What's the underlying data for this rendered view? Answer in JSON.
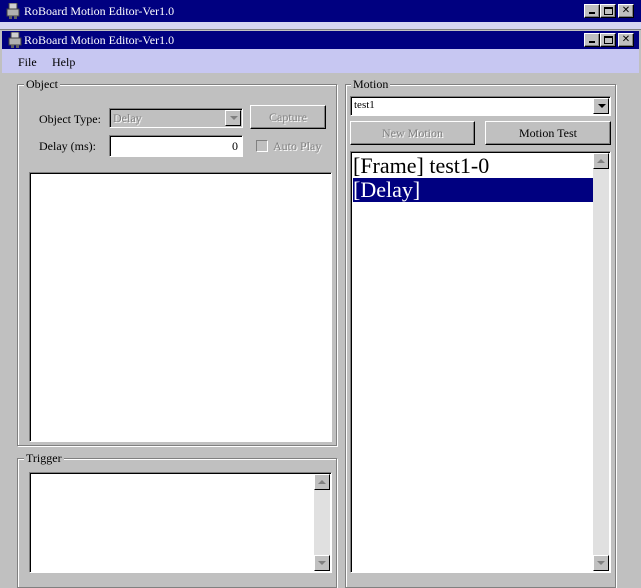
{
  "window_outer": {
    "title": "RoBoard Motion Editor-Ver1.0"
  },
  "window_inner": {
    "title": "RoBoard Motion Editor-Ver1.0"
  },
  "menu": {
    "file": "File",
    "help": "Help"
  },
  "object_group": {
    "label": "Object",
    "object_type_label": "Object Type:",
    "object_type_value": "Delay",
    "capture_button": "Capture",
    "delay_label": "Delay (ms):",
    "delay_value": "0",
    "auto_play_label": "Auto Play"
  },
  "trigger_group": {
    "label": "Trigger"
  },
  "motion_group": {
    "label": "Motion",
    "selected_motion": "test1",
    "new_motion_button": "New Motion",
    "motion_test_button": "Motion Test",
    "items": [
      {
        "label": "[Frame] test1-0",
        "selected": false
      },
      {
        "label": "[Delay]",
        "selected": true
      }
    ]
  },
  "colors": {
    "titlebar": "#000080",
    "menubar": "#c7c7f2",
    "face": "#c0c0c0",
    "selection": "#000080"
  }
}
